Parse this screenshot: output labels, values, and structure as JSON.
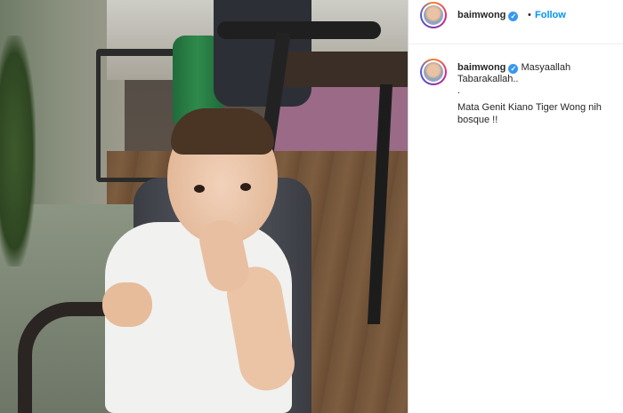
{
  "post": {
    "username": "baimwong",
    "follow_label": "Follow",
    "separator": "•",
    "verified_icon": "verified-badge-icon"
  },
  "caption": {
    "username": "baimwong",
    "line1": "Masyaallah",
    "line2": "Tabarakallah..",
    "line3": ".",
    "line4": "Mata Genit Kiano Tiger Wong nih bosque !!"
  },
  "colors": {
    "link": "#0095f6",
    "verified": "#3897f0",
    "text": "#262626",
    "border": "#dbdbdb"
  }
}
